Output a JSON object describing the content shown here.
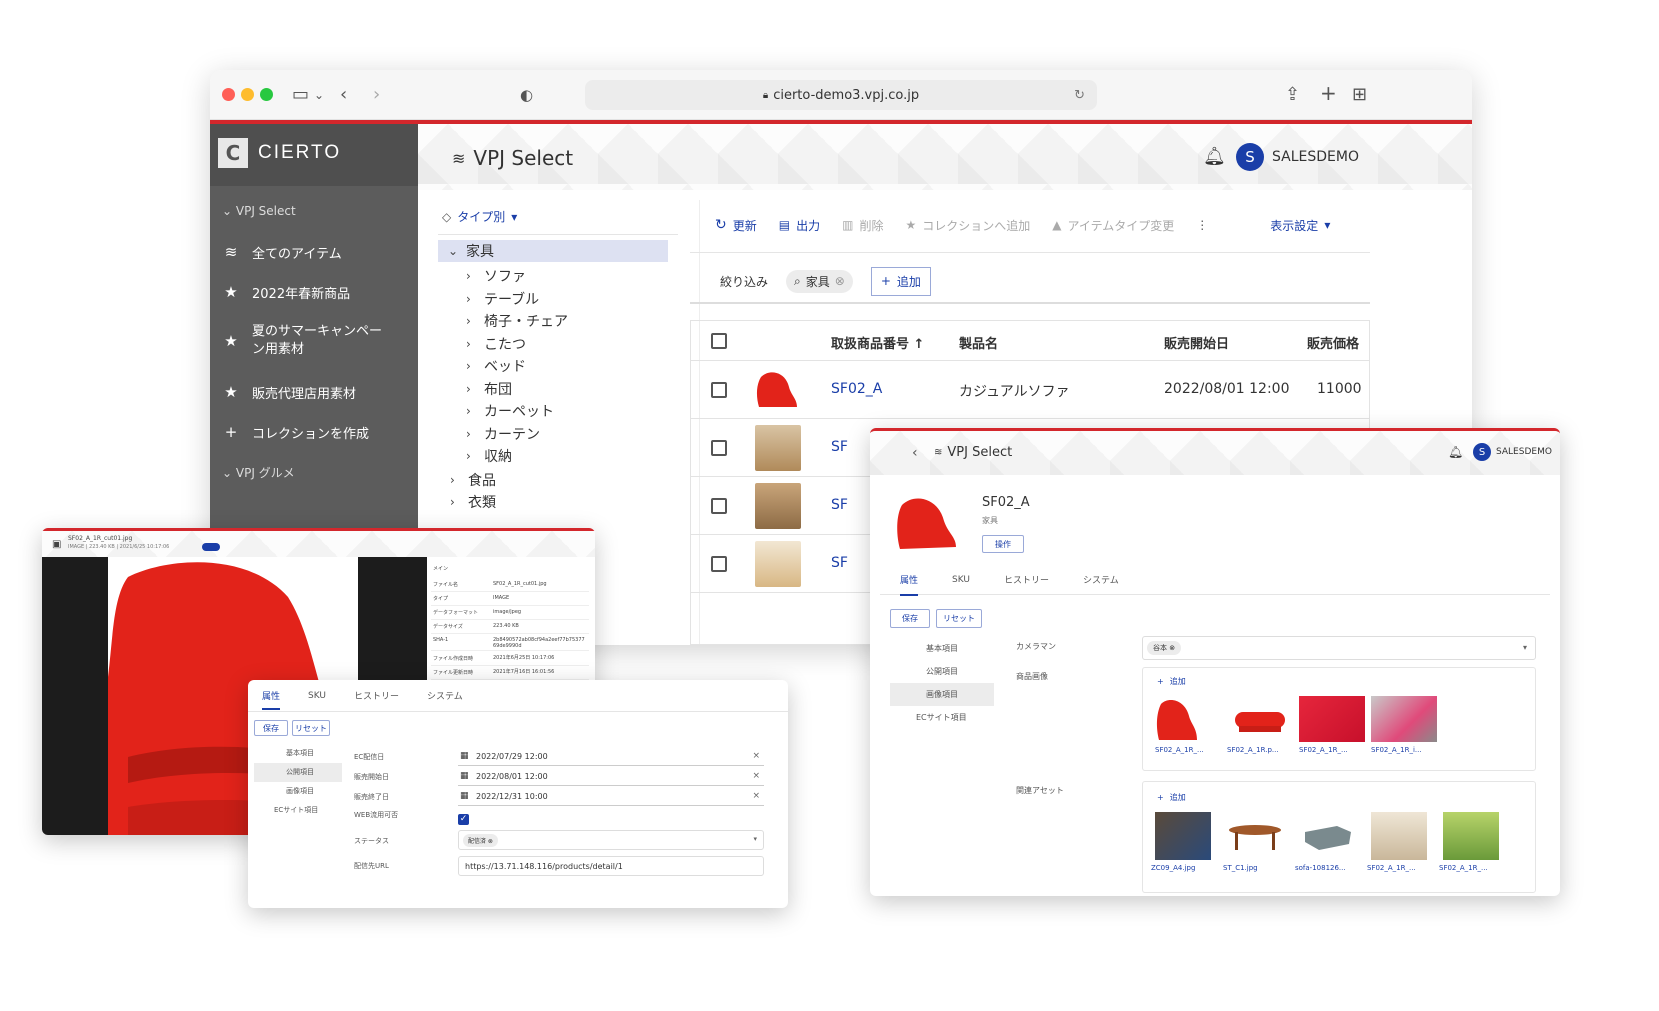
{
  "browser": {
    "url": "cierto-demo3.vpj.co.jp"
  },
  "brand": {
    "logo_text": "CIERTO"
  },
  "sidebar": {
    "section1": "VPJ Select",
    "items": [
      {
        "label": "全てのアイテム",
        "icon": "database-icon"
      },
      {
        "label": "2022年春新商品",
        "icon": "star-icon"
      },
      {
        "label": "夏のサマーキャンペーン用素材",
        "icon": "star-icon"
      },
      {
        "label": "販売代理店用素材",
        "icon": "star-icon"
      },
      {
        "label": "コレクションを作成",
        "icon": "plus-icon"
      }
    ],
    "section2": "VPJ グルメ"
  },
  "header": {
    "title": "VPJ Select",
    "user_initial": "S",
    "user_name": "SALESDEMO"
  },
  "tree": {
    "filter_label": "タイプ別",
    "root": "家具",
    "children": [
      "ソファ",
      "テーブル",
      "椅子・チェア",
      "こたつ",
      "ベッド",
      "布団",
      "カーペット",
      "カーテン",
      "収納"
    ],
    "siblings": [
      "食品",
      "衣類"
    ]
  },
  "toolbar": {
    "refresh": "更新",
    "export": "出力",
    "delete": "削除",
    "add_collection": "コレクションへ追加",
    "change_type": "アイテムタイプ変更",
    "view_settings": "表示設定"
  },
  "filter": {
    "label": "絞り込み",
    "chip": "家具",
    "add": "追加"
  },
  "table": {
    "headers": [
      "取扱商品番号",
      "製品名",
      "販売開始日",
      "販売価格"
    ],
    "rows": [
      {
        "id": "SF02_A",
        "name": "カジュアルソファ",
        "date": "2022/08/01 12:00",
        "price": "11000"
      },
      {
        "id": "SF",
        "name": "",
        "date": "",
        "price": ""
      },
      {
        "id": "SF",
        "name": "",
        "date": "",
        "price": ""
      },
      {
        "id": "SF",
        "name": "",
        "date": "",
        "price": ""
      }
    ]
  },
  "detail": {
    "title": "VPJ Select",
    "user_initial": "S",
    "user_name": "SALESDEMO",
    "item_id": "SF02_A",
    "item_type": "家具",
    "op_button": "操作",
    "tabs": [
      "属性",
      "SKU",
      "ヒストリー",
      "システム"
    ],
    "save": "保存",
    "reset": "リセット",
    "side_menu": [
      "基本項目",
      "公開項目",
      "画像項目",
      "ECサイト項目"
    ],
    "cameraman_label": "カメラマン",
    "cameraman_value": "谷本",
    "product_images_label": "商品画像",
    "add": "追加",
    "images": [
      "SF02_A_1R_...",
      "SF02_A_1R.p...",
      "SF02_A_1R_...",
      "SF02_A_1R_i..."
    ],
    "related_label": "関連アセット",
    "related": [
      "ZC09_A4.jpg",
      "ST_C1.jpg",
      "sofa-108126...",
      "SF02_A_1R_...",
      "SF02_A_1R_..."
    ]
  },
  "image_viewer": {
    "file": "SF02_A_1R_cut01.jpg",
    "meta_line": "IMAGE | 223.40 KB | 2021/6/25 10:17:06",
    "section": "メイン",
    "props": [
      {
        "k": "ファイル名",
        "v": "SF02_A_1R_cut01.jpg"
      },
      {
        "k": "タイプ",
        "v": "IMAGE"
      },
      {
        "k": "データフォーマット",
        "v": "image/jpeg"
      },
      {
        "k": "データサイズ",
        "v": "223.40 KB"
      },
      {
        "k": "SHA-1",
        "v": "2b8490572ab08cf94a2eef77b7537769de9990d"
      },
      {
        "k": "ファイル作成日時",
        "v": "2021年6月25日 10:17:06"
      },
      {
        "k": "ファイル更新日時",
        "v": "2021年7月16日 16:01:56"
      }
    ]
  },
  "attr_panel": {
    "tabs": [
      "属性",
      "SKU",
      "ヒストリー",
      "システム"
    ],
    "save": "保存",
    "reset": "リセット",
    "side_menu": [
      "基本項目",
      "公開項目",
      "画像項目",
      "ECサイト項目"
    ],
    "fields": [
      {
        "k": "EC配信日",
        "v": "2022/07/29 12:00"
      },
      {
        "k": "販売開始日",
        "v": "2022/08/01 12:00"
      },
      {
        "k": "販売終了日",
        "v": "2022/12/31 10:00"
      }
    ],
    "web_label": "WEB流用可否",
    "status_label": "ステータス",
    "status_value": "配信済",
    "url_label": "配信先URL",
    "url_value": "https://13.71.148.116/products/detail/1"
  },
  "colors": {
    "accent": "#1a3ea8",
    "brand_red": "#d3272c",
    "sidebar": "#5c5c5c"
  }
}
